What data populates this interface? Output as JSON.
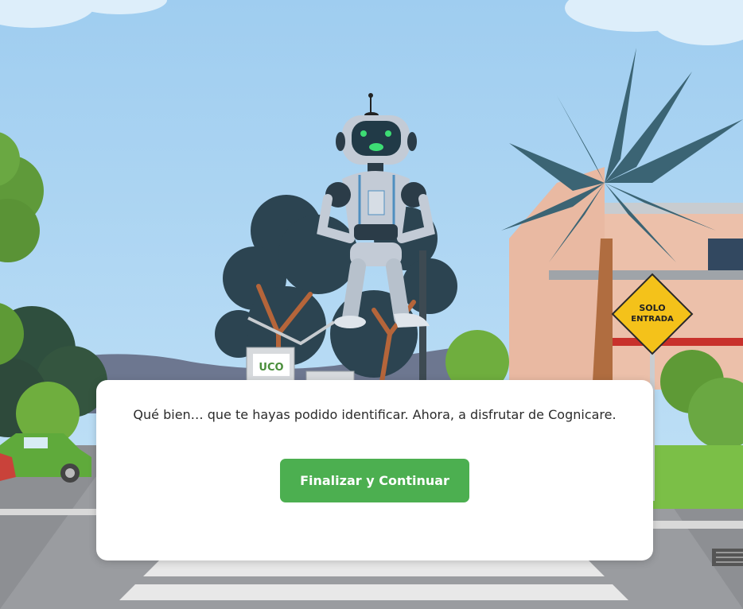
{
  "background": {
    "road_sign": {
      "line1": "SOLO",
      "line2": "ENTRADA"
    },
    "kiosk_logo": "UCO"
  },
  "dialog": {
    "message": "Qué bien… que te hayas podido identificar. Ahora, a disfrutar de Cognicare.",
    "button_label": "Finalizar y Continuar"
  },
  "colors": {
    "sky": "#a9d3f2",
    "button": "#4caf50",
    "sign": "#f4c21a",
    "robot_eyes": "#3ddc74"
  }
}
